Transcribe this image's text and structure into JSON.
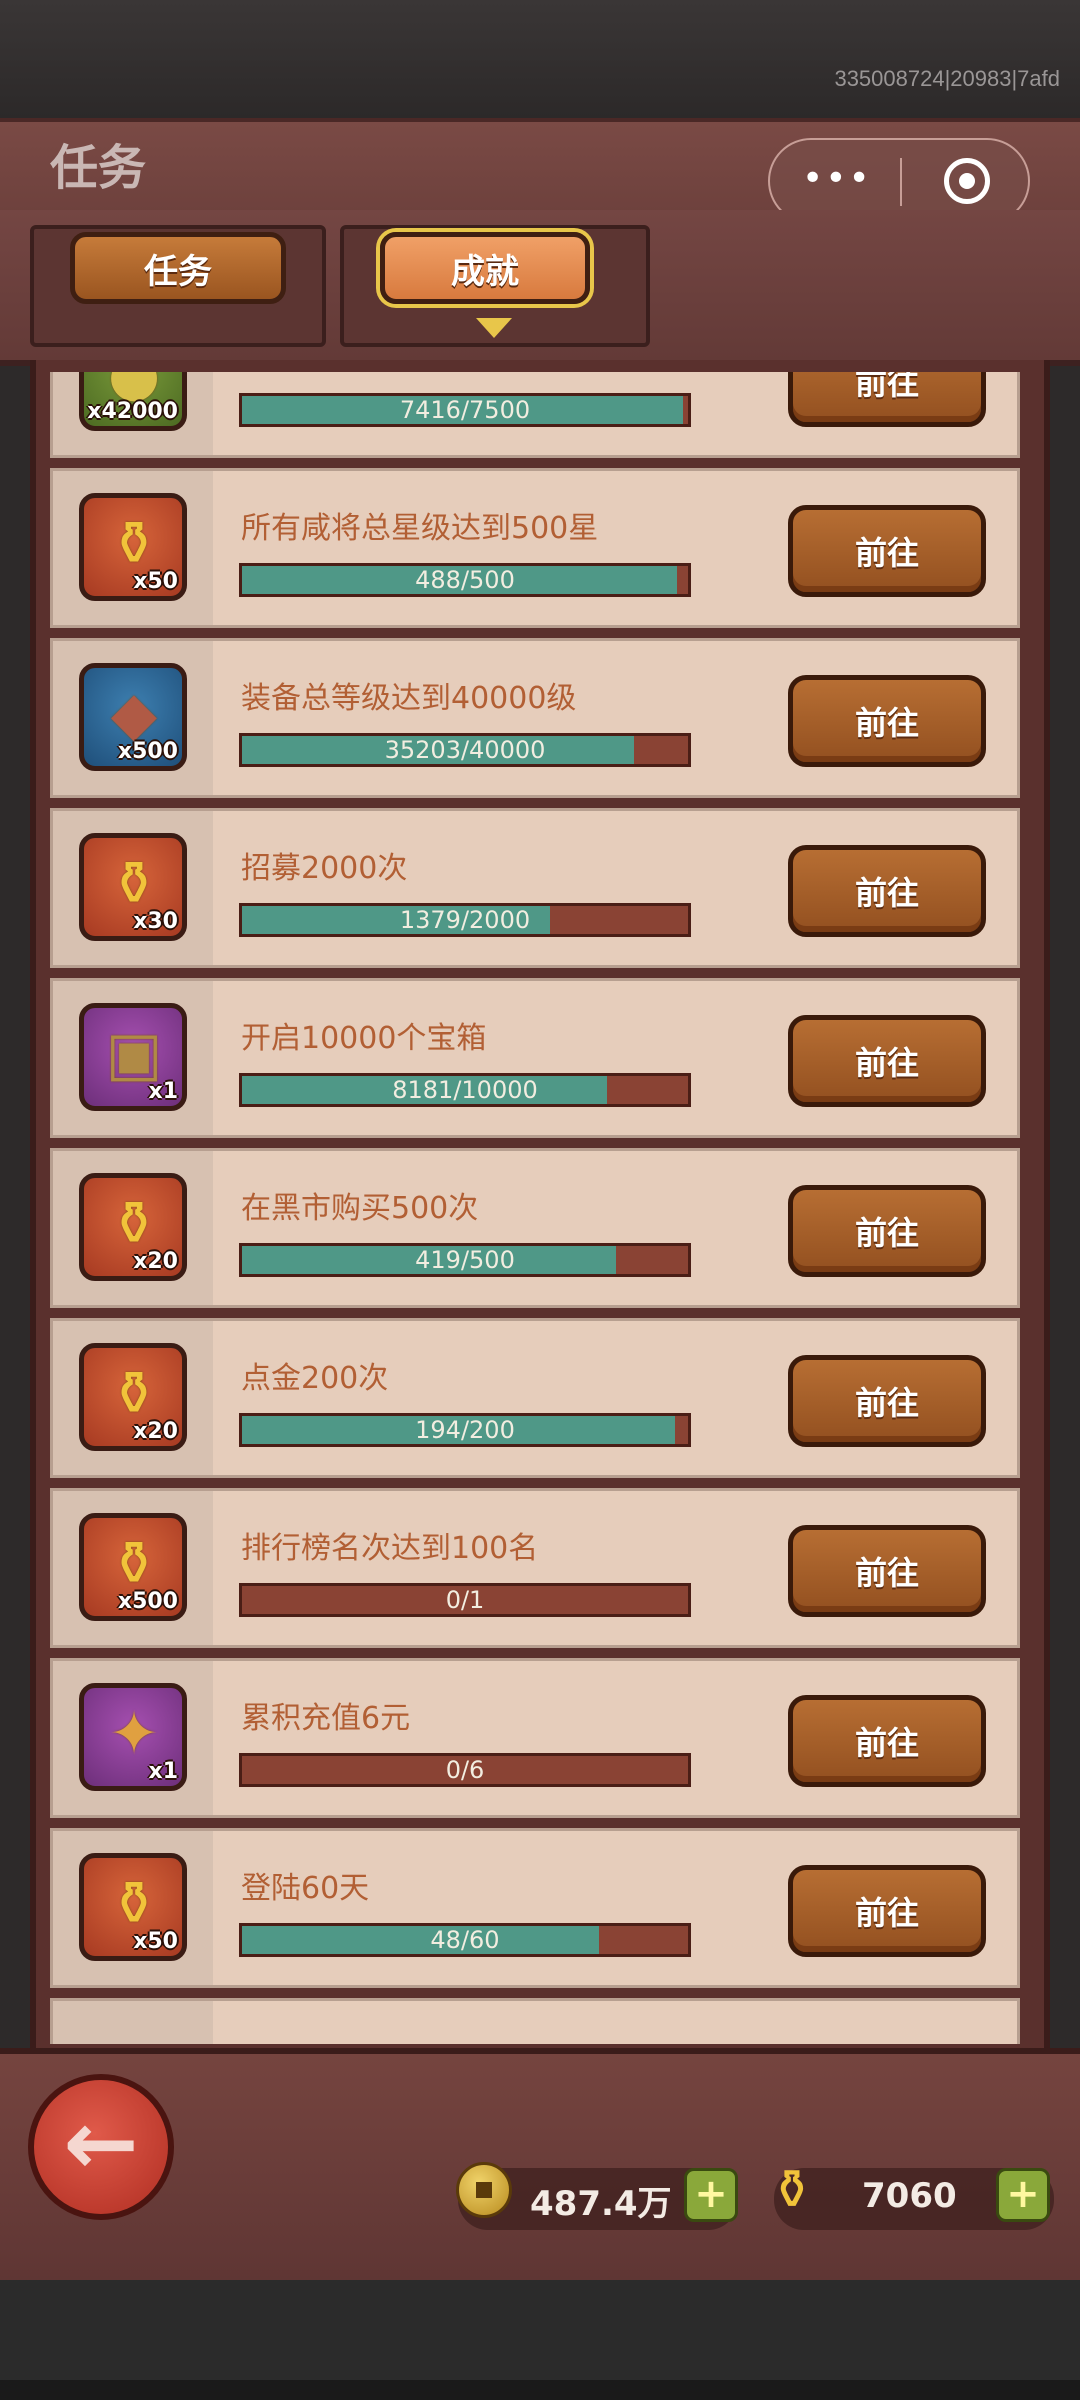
{
  "status": {
    "debug_id": "335008724|20983|7afd"
  },
  "header": {
    "title": "任务"
  },
  "tabs": [
    {
      "label": "任务",
      "active": false
    },
    {
      "label": "成就",
      "active": true
    }
  ],
  "achievements": [
    {
      "name": "",
      "reward_qty": "x42000",
      "progress_text": "7416/7500",
      "progress": 0.9888,
      "button": "前往",
      "icon": "green-item-icon",
      "icon_color": "green"
    },
    {
      "name": "所有咸将总星级达到500星",
      "reward_qty": "x50",
      "progress_text": "488/500",
      "progress": 0.976,
      "button": "前往",
      "icon": "gold-scroll-icon",
      "icon_color": "orange"
    },
    {
      "name": "装备总等级达到40000级",
      "reward_qty": "x500",
      "progress_text": "35203/40000",
      "progress": 0.88,
      "button": "前往",
      "icon": "stone-icon",
      "icon_color": "blue"
    },
    {
      "name": "招募2000次",
      "reward_qty": "x30",
      "progress_text": "1379/2000",
      "progress": 0.6895,
      "button": "前往",
      "icon": "gold-scroll-icon",
      "icon_color": "orange"
    },
    {
      "name": "开启10000个宝箱",
      "reward_qty": "x1",
      "progress_text": "8181/10000",
      "progress": 0.8181,
      "button": "前往",
      "icon": "treasure-chest-icon",
      "icon_color": "purple"
    },
    {
      "name": "在黑市购买500次",
      "reward_qty": "x20",
      "progress_text": "419/500",
      "progress": 0.838,
      "button": "前往",
      "icon": "gold-scroll-icon",
      "icon_color": "orange"
    },
    {
      "name": "点金200次",
      "reward_qty": "x20",
      "progress_text": "194/200",
      "progress": 0.97,
      "button": "前往",
      "icon": "gold-scroll-icon",
      "icon_color": "orange"
    },
    {
      "name": "排行榜名次达到100名",
      "reward_qty": "x500",
      "progress_text": "0/1",
      "progress": 0,
      "button": "前往",
      "icon": "gold-scroll-icon",
      "icon_color": "orange"
    },
    {
      "name": "累积充值6元",
      "reward_qty": "x1",
      "progress_text": "0/6",
      "progress": 0,
      "button": "前往",
      "icon": "torch-icon",
      "icon_color": "purple"
    },
    {
      "name": "登陆60天",
      "reward_qty": "x50",
      "progress_text": "48/60",
      "progress": 0.8,
      "button": "前往",
      "icon": "gold-scroll-icon",
      "icon_color": "orange"
    }
  ],
  "footer": {
    "coins": "487.4万",
    "scrolls": "7060",
    "plus": "+"
  },
  "capsule": {
    "menu": "•••"
  }
}
